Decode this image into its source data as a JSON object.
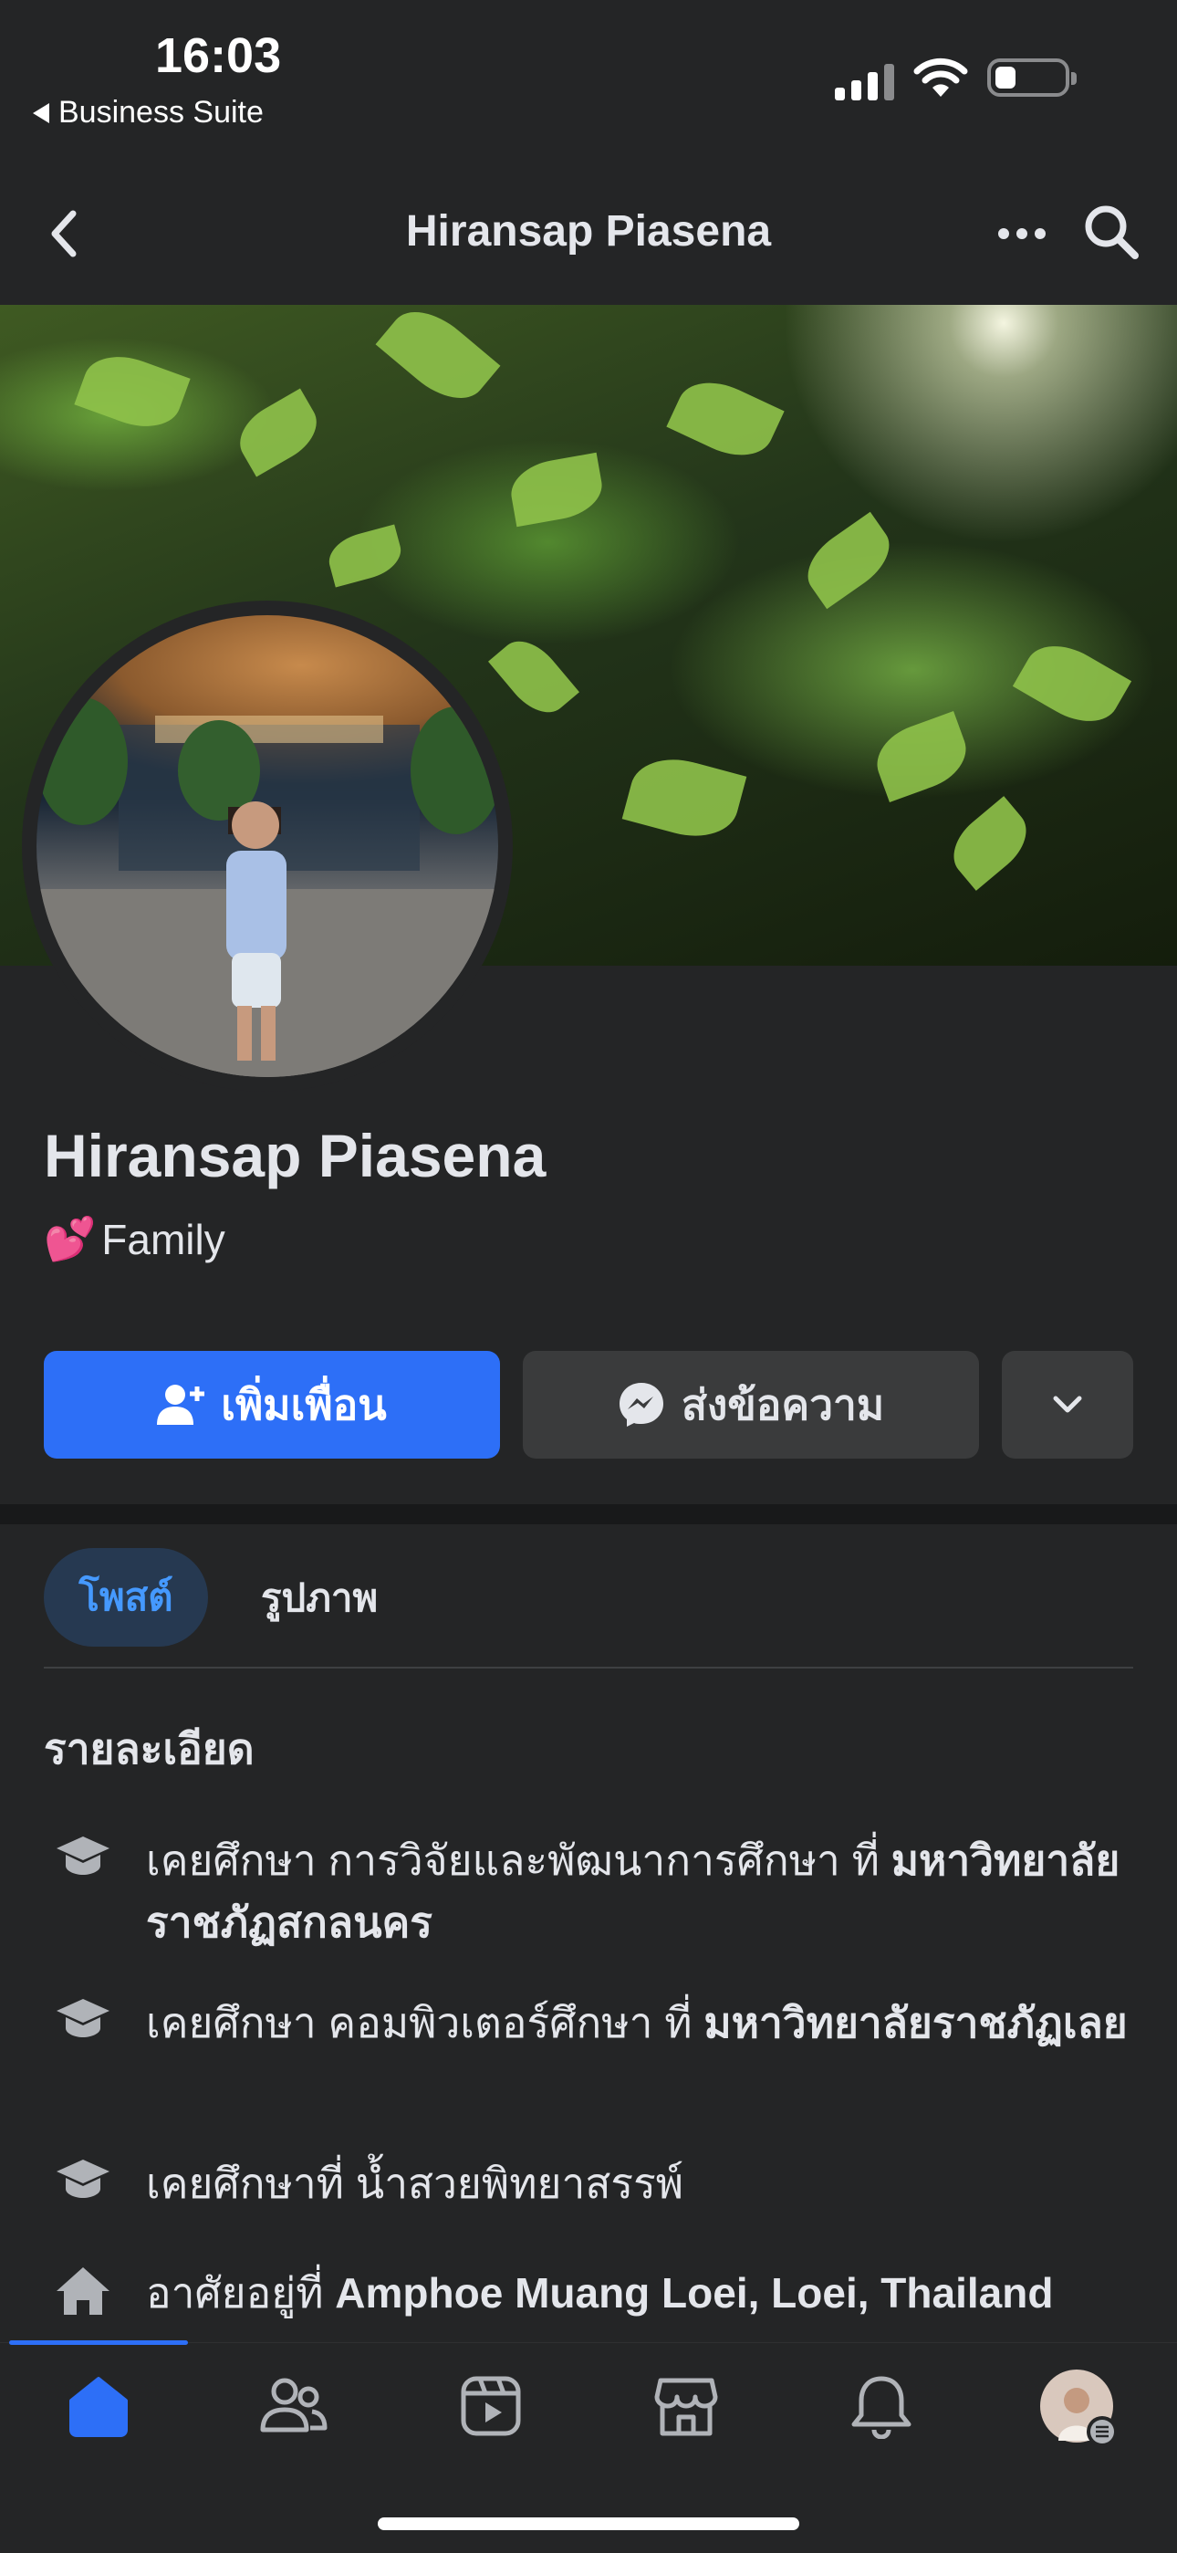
{
  "status_bar": {
    "time": "16:03",
    "back_app": "Business Suite"
  },
  "header": {
    "title": "Hiransap Piasena"
  },
  "profile": {
    "name": "Hiransap Piasena",
    "relation_emoji": "💕",
    "relation": "Family"
  },
  "actions": {
    "add_friend": "เพิ่มเพื่อน",
    "message": "ส่งข้อความ"
  },
  "tabs": [
    {
      "label": "โพสต์",
      "active": true
    },
    {
      "label": "รูปภาพ",
      "active": false
    }
  ],
  "details": {
    "title": "รายละเอียด",
    "items": [
      {
        "icon": "education-cap-icon",
        "prefix": "เคยศึกษา การวิจัยและพัฒนาการศึกษา ที่ ",
        "bold": "มหาวิทยาลัยราชภัฏสกลนคร"
      },
      {
        "icon": "education-cap-icon",
        "prefix": "เคยศึกษา คอมพิวเตอร์ศึกษา ที่ ",
        "bold": "มหาวิทยาลัยราชภัฏเลย"
      },
      {
        "icon": "education-cap-icon",
        "prefix": "เคยศึกษาที่ น้ำสวยพิทยาสรรพ์",
        "bold": ""
      },
      {
        "icon": "home-icon",
        "prefix": "อาศัยอยู่ที่ ",
        "bold": "Amphoe Muang Loei, Loei, Thailand"
      }
    ]
  },
  "bottom_nav": [
    {
      "icon": "home-icon",
      "active": true
    },
    {
      "icon": "friends-icon",
      "active": false
    },
    {
      "icon": "video-icon",
      "active": false
    },
    {
      "icon": "marketplace-icon",
      "active": false
    },
    {
      "icon": "bell-icon",
      "active": false
    },
    {
      "icon": "profile-menu-icon",
      "active": false
    }
  ],
  "colors": {
    "background": "#242526",
    "accent": "#2d6ff7",
    "secondary_button": "#3a3b3c",
    "tab_active_bg": "#263951",
    "tab_active_text": "#4599ff"
  }
}
